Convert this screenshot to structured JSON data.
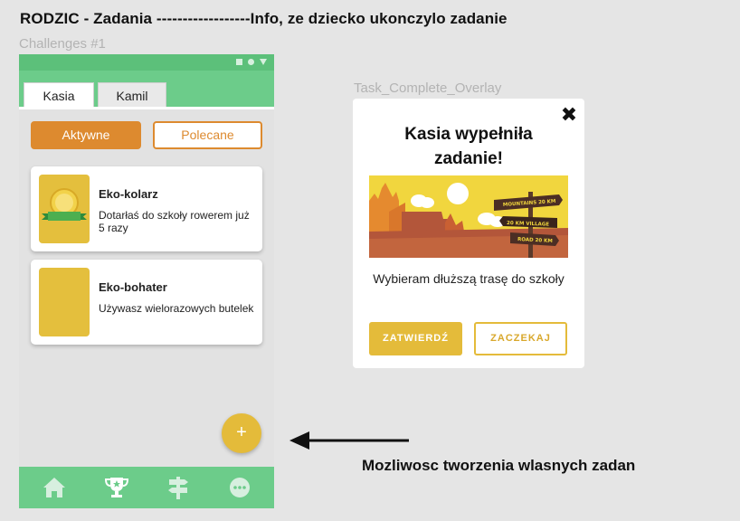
{
  "heading": "RODZIC - Zadania ------------------Info, ze dziecko ukonczylo zadanie",
  "frame_label": "Challenges #1",
  "overlay_label": "Task_Complete_Overlay",
  "phone": {
    "tabs": [
      {
        "label": "Kasia",
        "active": true
      },
      {
        "label": "Kamil",
        "active": false
      }
    ],
    "filters": {
      "active_label": "Aktywne",
      "recommended_label": "Polecane"
    },
    "challenges": [
      {
        "title": "Eko-kolarz",
        "description": "Dotarłaś do szkoły rowerem już 5 razy",
        "icon": "medal-icon"
      },
      {
        "title": "Eko-bohater",
        "description": "Używasz wielorazowych butelek",
        "icon": ""
      }
    ],
    "fab_label": "+",
    "bottom_nav": [
      "home-icon",
      "trophy-icon",
      "signpost-icon",
      "more-icon"
    ]
  },
  "overlay": {
    "close_label": "✖",
    "title": "Kasia wypełniła zadanie!",
    "task": "Wybieram dłuższą trasę do szkoły",
    "sign_texts": [
      "MOUNTAINS 20 KM",
      "20 KM VILLAGE",
      "ROAD 20 KM"
    ],
    "confirm_label": "ZATWIERDŹ",
    "wait_label": "ZACZEKAJ"
  },
  "annotation": "Mozliwosc tworzenia wlasnych zadan",
  "colors": {
    "green": "#6ccc8a",
    "orange": "#dd8a2f",
    "yellow": "#e4bb3a",
    "background": "#e5e5e5"
  }
}
